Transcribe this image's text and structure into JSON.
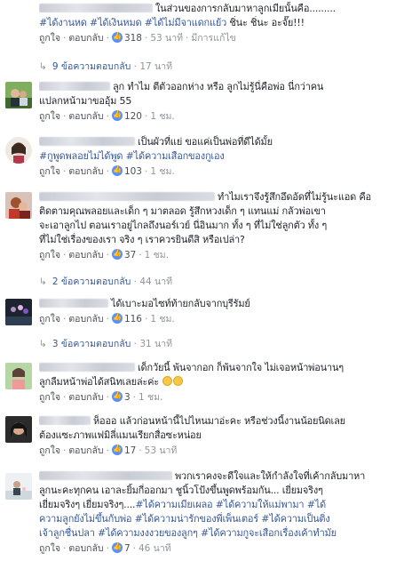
{
  "ui": {
    "like": "ถูกใจ",
    "reply": "ตอบกลับ",
    "dot": "·"
  },
  "comments": [
    {
      "line1": "ในส่วนของการกลับมาหาลูกเมียนั้นคือ.........",
      "line2_tags": "#ได้งานหด #ได้เงินหมด #ได้ไม่มีจาแดกแย้ว",
      "line2_rest": " ชิ่นะ ชิ่นะ อะจั๊ย!!!",
      "likes": "318",
      "time": "53 นาที",
      "extra": "มีการแก้ไข"
    },
    {
      "line1": "ลูก ทำไม ตีตัวออกห่าง หรือ ลูกไม่รู้นี่คือพ่อ นี่กว่าคน",
      "line2": "แปลกหน้ามาขออุ้ม 55",
      "likes": "120",
      "time": "1 ชม."
    },
    {
      "line1": "เป็นผัวที่แย่ ขอแค่เป็นพ่อที่ดีได้มั้ย",
      "line2_tags": "#กูพูดพลอยไม่ได้พูด #ได้ความเสือกของกูเอง",
      "likes": "103",
      "time": "1 ชม."
    },
    {
      "line1": "ทำไมเราจึงรู้สึกอึดอัดที่ไม่รู้นะแอด คือ",
      "line2": "ติดตามคุณพลอยและเด็ก ๆ มาตลอด รู้สึกหวงเด็ก ๆ แทนแม่ กลัวพ่อเขา",
      "line3": "จะเอาลูกไป ตอนเราอยู่ไกลถึงนอร์เวย์ นี่อินมาก ทั้ง ๆ ที่ไม่ใช่ลูกตัว ทั้ง ๆ",
      "line4": "ที่ไม่ใช่เรื่องของเรา จริง ๆ เราควรยินดีสิ หรือเปล่า?",
      "likes": "37",
      "time": "1 ชม.",
      "replies": "2 ข้อความตอบกลับ",
      "replies_time": "44 นาที"
    },
    {
      "line1": "ได้เบาะมอไซท์ท้ายกลับจากบุรีรัมย์",
      "likes": "116",
      "time": "1 ชม.",
      "replies": "3 ข้อความตอบกลับ",
      "replies_time": "31 นาที"
    },
    {
      "line1": "เด็กวัยนี้ พ้นจากอก ก็พ้นจากใจ ไม่เจอหน้าพ่อนานๆ",
      "line2": "ลูกลืมหน้าพ่อได้สนิทเลยล่ะค่ะ",
      "likes": "3",
      "time": "1 ชม."
    },
    {
      "line1": "ห็อออ แล้วก่อนหน้านี้ไปไหนมาอ่ะคะ หรือช่วงนี้งานน้อยนิดเลย",
      "line2": "ต้องแซะภาพแฟมิลี่แมนเรียกสื่อซะหน่อย",
      "likes": "17",
      "time": "53 นาที"
    },
    {
      "line1": "พวกเราคงจะดีใจและให้กำลังใจที่เค้ากลับมาหา",
      "line2": "ลูกนะคะทุกคน เอาละยิ้มกี่ออกมา ชูนิ้วโป้งขึ้นพูดพร้อมกัน... เยี่ยมจริงๆ",
      "line3_plain": "เยี่ยมจริงๆ เยี่ยมจริงๆ....",
      "line3_tags": "#ได้ความเมียเผลอ #ได้ความให้แม่พามา #ได้",
      "line4_tags": "ความลูกยังไม่ขึ้นกับพ่อ #ได้ความน่ารักของพี่เพ็นเตอร์ #ได้ความเป็นติ่ง",
      "line5_tags": "เจ้าลูกชื่นปลา #ได้ความงงงวยของลูกๆ #ได้ความกูจะเสือกเรื่องเค้าทำมัย",
      "likes": "7",
      "time": "46 นาที"
    }
  ],
  "colors": {
    "link": "#365899",
    "meta": "#90949c",
    "text": "#1d2129",
    "like_badge": "#5890ff"
  }
}
